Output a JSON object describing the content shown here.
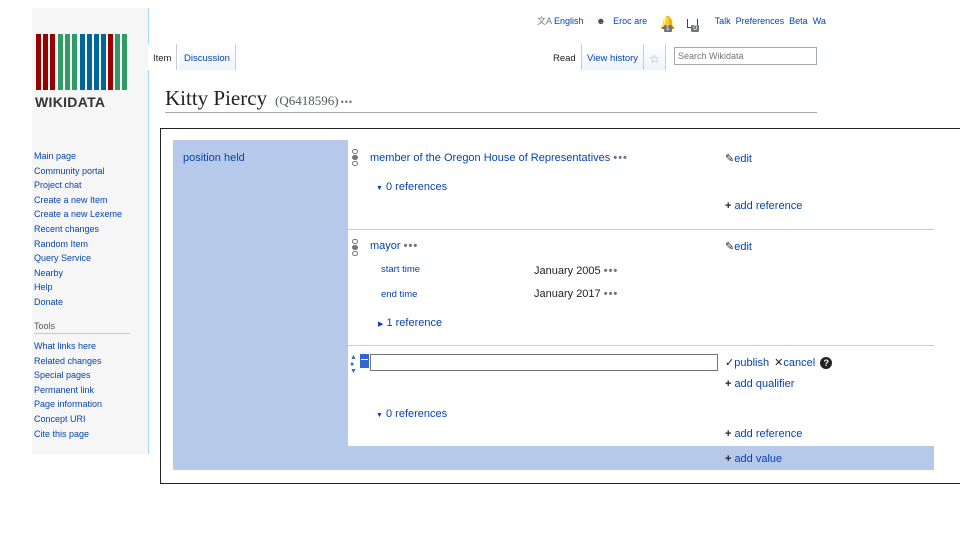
{
  "logo": {
    "text": "WIKIDATA",
    "bar_colors": [
      "#990000",
      "#339966",
      "#006699"
    ]
  },
  "personal": {
    "language": "English",
    "user": "Eroc are",
    "notice_count": "1",
    "message_count": "0",
    "links": [
      "Talk",
      "Preferences",
      "Beta",
      "Wa"
    ]
  },
  "sidebar": {
    "main": [
      "Main page",
      "Community portal",
      "Project chat",
      "Create a new Item",
      "Create a new Lexeme",
      "Recent changes",
      "Random Item",
      "Query Service",
      "Nearby",
      "Help",
      "Donate"
    ],
    "tools_heading": "Tools",
    "tools": [
      "What links here",
      "Related changes",
      "Special pages",
      "Permanent link",
      "Page information",
      "Concept URI",
      "Cite this page"
    ]
  },
  "tabs": {
    "item": "Item",
    "discussion": "Discussion",
    "read": "Read",
    "history": "View history"
  },
  "search": {
    "placeholder": "Search Wikidata"
  },
  "page": {
    "title": "Kitty Piercy",
    "qid": "(Q6418596)",
    "more": "•••"
  },
  "property": {
    "label": "position held"
  },
  "statements": [
    {
      "value": "member of the Oregon House of Representatives",
      "refs": "0 references",
      "add_reference": "add reference"
    },
    {
      "value": "mayor",
      "qualifiers": [
        {
          "label": "start time",
          "value": "January 2005"
        },
        {
          "label": "end time",
          "value": "January 2017"
        }
      ],
      "refs": "1 reference"
    }
  ],
  "new_statement": {
    "publish": "publish",
    "cancel": "cancel",
    "add_qualifier": "add qualifier",
    "refs": "0 references",
    "add_reference": "add reference"
  },
  "actions": {
    "edit": "edit",
    "add_value": "add value",
    "help": "?"
  },
  "colors": {
    "link": "#0645ad",
    "group_bg": "#b7c9ea"
  }
}
